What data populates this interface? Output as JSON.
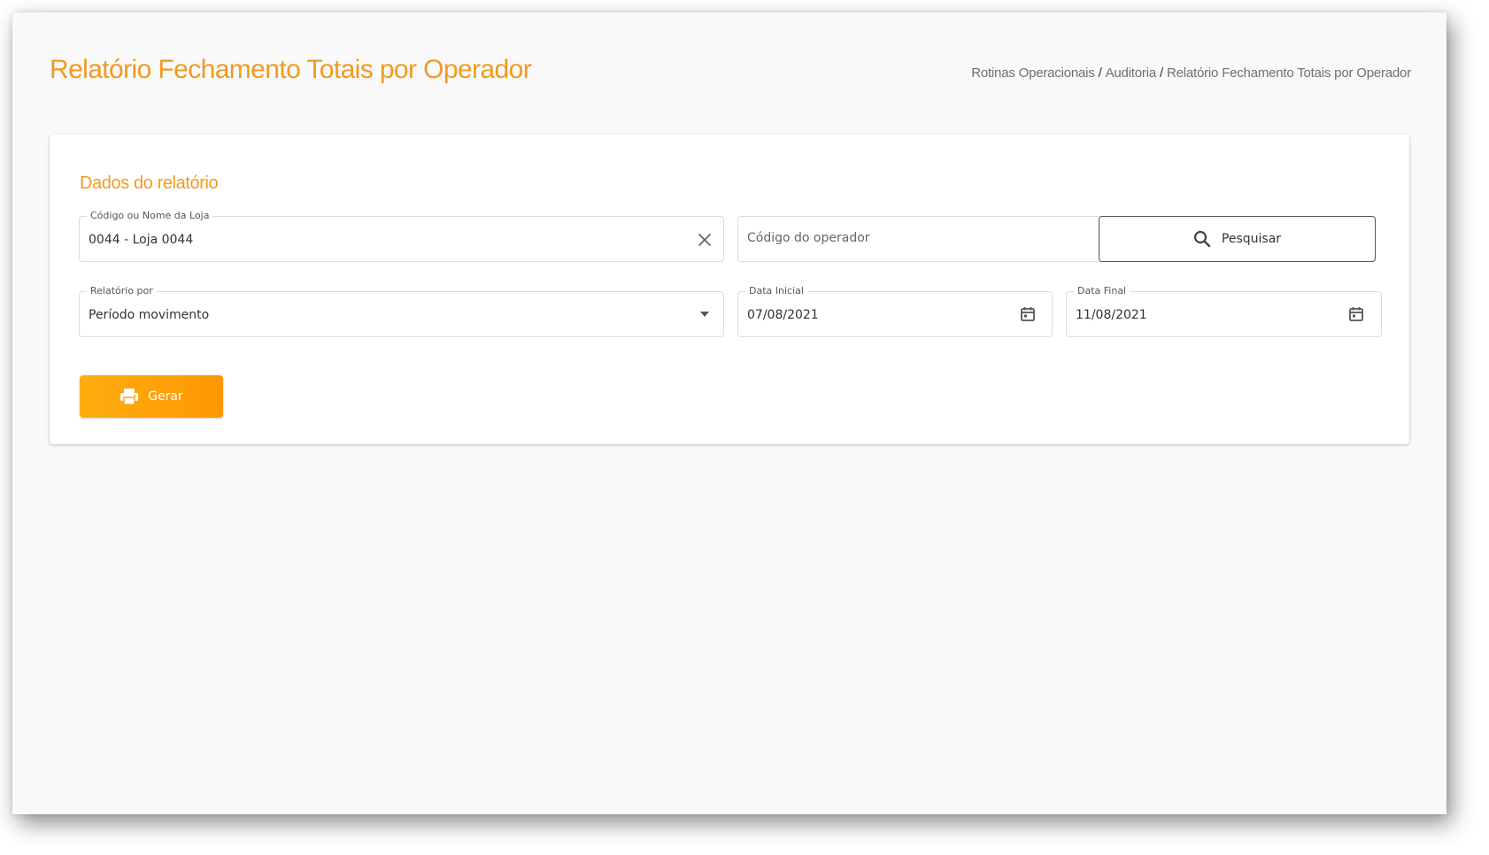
{
  "page": {
    "title": "Relatório Fechamento Totais por Operador"
  },
  "breadcrumb": {
    "items": [
      "Rotinas Operacionais",
      "Auditoria",
      "Relatório Fechamento Totais por Operador"
    ],
    "separator": "/"
  },
  "form": {
    "section_title": "Dados do relatório",
    "store": {
      "label": "Código ou Nome da Loja",
      "value": "0044 - Loja 0044",
      "clear_icon": "close-icon"
    },
    "operator": {
      "placeholder": "Código do operador"
    },
    "search_button": {
      "label": "Pesquisar",
      "icon": "search-icon"
    },
    "report_by": {
      "label": "Relatório por",
      "value": "Período movimento",
      "icon": "chevron-down-icon"
    },
    "start_date": {
      "label": "Data Inicial",
      "value": "07/08/2021",
      "icon": "calendar-icon"
    },
    "end_date": {
      "label": "Data Final",
      "value": "11/08/2021",
      "icon": "calendar-icon"
    },
    "generate_button": {
      "label": "Gerar",
      "icon": "printer-icon"
    }
  },
  "colors": {
    "accent": "#f29a1f",
    "button_gradient_start": "#ffad10",
    "button_gradient_end": "#ff9700",
    "background": "#f9f9f9",
    "card": "#ffffff"
  }
}
